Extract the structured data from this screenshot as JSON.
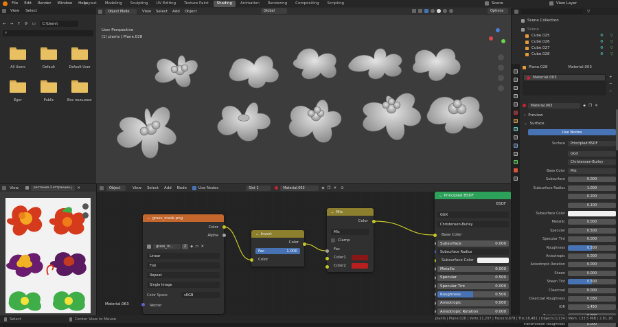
{
  "menus": [
    "File",
    "Edit",
    "Render",
    "Window",
    "Help"
  ],
  "workspaces": [
    "Layout",
    "Modeling",
    "Sculpting",
    "UV Editing",
    "Texture Paint",
    "Shading",
    "Animation",
    "Rendering",
    "Compositing",
    "Scripting"
  ],
  "active_workspace": "Shading",
  "scene": "Scene",
  "view_layer": "View Layer",
  "filebrowser": {
    "menu": [
      "View",
      "Select"
    ],
    "path": "C:\\Users\\",
    "folders": [
      "All Users",
      "Default",
      "Default User",
      "Egor",
      "Public",
      "Все пользоват..."
    ]
  },
  "viewport": {
    "mode": "Object Mode",
    "menu": [
      "View",
      "Select",
      "Add",
      "Object"
    ],
    "orientation": "Global",
    "options": "Options",
    "info1": "User Perspective",
    "info2": "(1) plants | Plane.028"
  },
  "outliner": {
    "title": "Scene Collection",
    "items": [
      "Scene",
      "Cube.025",
      "Cube.026",
      "Cube.027",
      "Cube.028"
    ]
  },
  "properties": {
    "object": "Plane.028",
    "material_slot": "Material.003",
    "material": "Material.063",
    "preview": "Preview",
    "surface_section": "Surface",
    "use_nodes": "Use Nodes",
    "surface": {
      "label": "Surface",
      "value": "Principled BSDF"
    },
    "dist1": "GGX",
    "dist2": "Christensen-Burley",
    "rows": [
      {
        "label": "Base Color",
        "value": "Mix"
      },
      {
        "label": "Subsurface",
        "value": "0.000"
      },
      {
        "label": "Subsurface Radius",
        "value": "1.000"
      },
      {
        "label": "",
        "value": "0.200"
      },
      {
        "label": "",
        "value": "0.100"
      },
      {
        "label": "Subsurface Color",
        "value": ""
      },
      {
        "label": "Metallic",
        "value": "0.000"
      },
      {
        "label": "Specular",
        "value": "0.500"
      },
      {
        "label": "Specular Tint",
        "value": "0.000"
      },
      {
        "label": "Roughness",
        "value": "0.500"
      },
      {
        "label": "Anisotropic",
        "value": "0.000"
      },
      {
        "label": "Anisotropic Rotation",
        "value": "0.000"
      },
      {
        "label": "Sheen",
        "value": "0.000"
      },
      {
        "label": "Sheen Tint",
        "value": "0.500"
      },
      {
        "label": "Clearcoat",
        "value": "0.000"
      },
      {
        "label": "Clearcoat Roughness",
        "value": "0.030"
      },
      {
        "label": "IOR",
        "value": "1.450"
      },
      {
        "label": "Transmission",
        "value": "0.000"
      },
      {
        "label": "Transmission Roughness",
        "value": "0.000"
      }
    ]
  },
  "image_editor": {
    "menu": [
      "View"
    ],
    "image": "растения 3 аттракцие.j"
  },
  "node_editor": {
    "type": "Object",
    "menu": [
      "View",
      "Select",
      "Add",
      "Node"
    ],
    "use_nodes": "Use Nodes",
    "slot": "Slot 1",
    "material": "Material.063",
    "footer_label": "Material.063"
  },
  "nodes": {
    "image": {
      "title": "grass_mask.png",
      "out_color": "Color",
      "out_alpha": "Alpha",
      "img_name": "grass_m...",
      "users": "2",
      "interp": "Linear",
      "proj": "Flat",
      "ext": "Repeat",
      "source": "Single Image",
      "cs_label": "Color Space",
      "cs_value": "sRGB",
      "vector": "Vector"
    },
    "invert": {
      "title": "Invert",
      "out": "Color",
      "fac": "Fac",
      "fac_val": "1.000",
      "color": "Color"
    },
    "mix": {
      "title": "Mix",
      "out": "Color",
      "blend": "Mix",
      "clamp": "Clamp",
      "fac": "Fac",
      "color1": "Color1",
      "color2": "Color2"
    },
    "bsdf": {
      "title": "Principled BSDF",
      "out": "BSDF",
      "dist1": "GGX",
      "dist2": "Christensen-Burley",
      "base": "Base Color",
      "rows": [
        {
          "label": "Subsurface",
          "value": "0.000"
        },
        {
          "label": "Subsurface Radius",
          "value": ""
        },
        {
          "label": "Subsurface Color",
          "value": ""
        },
        {
          "label": "Metallic",
          "value": "0.000"
        },
        {
          "label": "Specular",
          "value": "0.500"
        },
        {
          "label": "Specular Tint",
          "value": "0.000"
        },
        {
          "label": "Roughness",
          "value": "0.500"
        },
        {
          "label": "Anisotropic",
          "value": "0.000"
        },
        {
          "label": "Anisotropic Rotation",
          "value": "0.000"
        }
      ]
    }
  },
  "status": {
    "select": "Select",
    "center": "Center View to Mouse",
    "right": "plants | Plane.028 | Verts:11,207 | Faces:9,679 | Tris:18,481 | Objects:1/134 | Mem: 133.5 MiB | 2.81.16"
  },
  "colors": {
    "accent": "#4772b3",
    "header_active": "#e39a3b",
    "image_node": "#c5662d",
    "invert_node": "#8c7f2d",
    "mix_node": "#8c7f2d",
    "bsdf_node": "#2da15a",
    "mix_c1": "#8a1717",
    "mix_c2": "#b81f1f"
  }
}
